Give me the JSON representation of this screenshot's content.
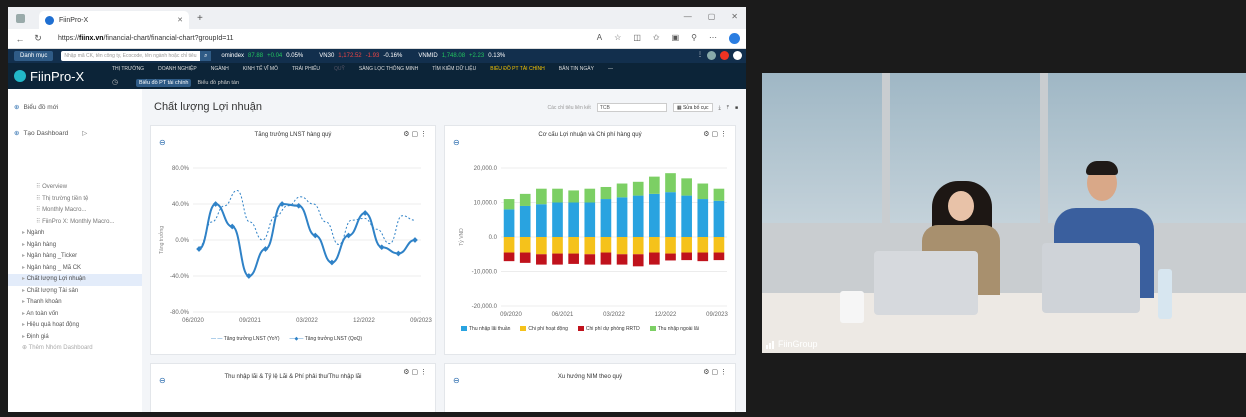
{
  "browser": {
    "tab_title": "FiinPro-X",
    "url_prefix": "https://",
    "url_host": "fiinx.vn",
    "url_path": "/financial-chart/financial-chart?groupId=11"
  },
  "topbar": {
    "menu_button": "Danh mục",
    "search_placeholder": "Nhập mã CK, tên công ty, Ecocode, tên ngành hoặc chỉ tiêu",
    "tickers": [
      {
        "name": "omindex",
        "value": "87.88",
        "change": "+0.04",
        "pct": "0.05%",
        "dir": "up"
      },
      {
        "name": "VN30",
        "value": "1,172.52",
        "change": "-1.93",
        "pct": "-0.16%",
        "dir": "dn"
      },
      {
        "name": "VNMID",
        "value": "1,748.08",
        "change": "+2.23",
        "pct": "0.13%",
        "dir": "up"
      }
    ]
  },
  "app": {
    "logo": "FiinPro-X",
    "menu": [
      "THỊ TRƯỜNG",
      "DOANH NGHIỆP",
      "NGÀNH",
      "KINH TẾ VĨ MÔ",
      "TRÁI PHIẾU",
      "QUỸ",
      "SÀNG LỌC THÔNG MINH",
      "TÌM KIẾM DỮ LIỆU",
      "BIỂU ĐỒ PT TÀI CHÍNH",
      "BẢN TIN NGÀY"
    ],
    "active_menu": "BIỂU ĐỒ PT TÀI CHÍNH",
    "submenu": [
      "Biểu đồ PT tài chính",
      "Biểu đồ phân tán"
    ]
  },
  "sidebar": {
    "new_chart": "Biểu đồ mới",
    "new_dashboard": "Tạo Dashboard",
    "items": [
      {
        "label": "Overview",
        "level": 2
      },
      {
        "label": "Thị trường tiền tệ",
        "level": 2
      },
      {
        "label": "Monthly Macro...",
        "level": 2
      },
      {
        "label": "FiinPro X: Monthly Macro...",
        "level": 2
      },
      {
        "label": "Ngành",
        "level": 1
      },
      {
        "label": "Ngân hàng",
        "level": 1
      },
      {
        "label": "Ngân hàng _Ticker",
        "level": 1
      },
      {
        "label": "Ngân hàng _ Mã CK",
        "level": 1
      },
      {
        "label": "Chất lượng Lợi nhuận",
        "level": 1,
        "selected": true
      },
      {
        "label": "Chất lượng Tài sản",
        "level": 1
      },
      {
        "label": "Thanh khoản",
        "level": 1
      },
      {
        "label": "An toàn vốn",
        "level": 1
      },
      {
        "label": "Hiệu quả hoạt động",
        "level": 1
      },
      {
        "label": "Định giá",
        "level": 1
      },
      {
        "label": "Thêm Nhóm Dashboard",
        "level": 1,
        "muted": true
      }
    ]
  },
  "page": {
    "title": "Chất lượng Lợi nhuận",
    "linked_label": "Các chỉ tiêu liên kết",
    "linked_value": "TCB",
    "layout_button": "Sửa bố cục"
  },
  "cards": {
    "card3_title": "Thu nhập lãi & Tỷ lệ Lãi & Phí phải thu/Thu nhập lãi",
    "card4_title": "Xu hướng NIM theo quý"
  },
  "camera": {
    "label": "FiinGroup"
  },
  "chart_data": [
    {
      "type": "line",
      "title": "Tăng trưởng LNST hàng quý",
      "ylabel": "Tăng trưởng",
      "ylim": [
        -80,
        80
      ],
      "yticks": [
        "80.0%",
        "40.0%",
        "0.0%",
        "-40.0%",
        "-80.0%"
      ],
      "x_tick_labels": [
        "06/2020",
        "09/2021",
        "03/2022",
        "12/2022",
        "09/2023"
      ],
      "series": [
        {
          "name": "Tăng trưởng LNST (YoY)",
          "style": "dashed",
          "color": "#2f82c7",
          "values": [
            -8,
            20,
            38,
            55,
            20,
            0,
            26,
            38,
            48,
            40,
            20,
            -5,
            22,
            24,
            12,
            -4,
            27,
            22
          ]
        },
        {
          "name": "Tăng trưởng LNST (QoQ)",
          "style": "solid",
          "color": "#2f82c7",
          "values": [
            -10,
            40,
            15,
            -40,
            -10,
            40,
            38,
            5,
            -25,
            5,
            30,
            -8,
            -15,
            0
          ]
        }
      ]
    },
    {
      "type": "bar",
      "stacked": true,
      "title": "Cơ cấu Lợi nhuận và Chi phí hàng quý",
      "ylabel": "Tỷ VND",
      "ylim": [
        -20000,
        20000
      ],
      "yticks": [
        "20,000.0",
        "10,000.0",
        "0.0",
        "-10,000.0",
        "-20,000.0"
      ],
      "x_tick_labels": [
        "09/2020",
        "06/2021",
        "03/2022",
        "12/2022",
        "09/2023"
      ],
      "categories": [
        "Q3/2020",
        "Q4/2020",
        "Q1/2021",
        "Q2/2021",
        "Q3/2021",
        "Q4/2021",
        "Q1/2022",
        "Q2/2022",
        "Q3/2022",
        "Q4/2022",
        "Q1/2023",
        "Q2/2023",
        "Q3/2023",
        "Q4/2023"
      ],
      "series": [
        {
          "name": "Thu nhập lãi thuần",
          "color": "#29a3e0",
          "values": [
            8000,
            9000,
            9500,
            10000,
            10000,
            10000,
            11000,
            11500,
            12000,
            12500,
            13000,
            12000,
            11000,
            10500
          ]
        },
        {
          "name": "Chi phí hoạt động",
          "color": "#f5c21b",
          "values": [
            -4500,
            -4500,
            -5000,
            -4800,
            -4800,
            -5000,
            -4500,
            -5000,
            -5000,
            -4500,
            -4800,
            -4500,
            -4500,
            -4500
          ]
        },
        {
          "name": "Chi phí dự phòng RRTD",
          "color": "#c0121c",
          "values": [
            -2500,
            -3000,
            -3000,
            -3200,
            -3000,
            -3000,
            -3500,
            -3000,
            -3500,
            -3500,
            -2000,
            -2200,
            -2500,
            -2200
          ]
        },
        {
          "name": "Thu nhập ngoài lãi",
          "color": "#7ccf64",
          "values": [
            3000,
            3500,
            4500,
            4000,
            3500,
            4000,
            3500,
            4000,
            4000,
            5000,
            5500,
            5000,
            4500,
            3500
          ]
        }
      ]
    }
  ]
}
